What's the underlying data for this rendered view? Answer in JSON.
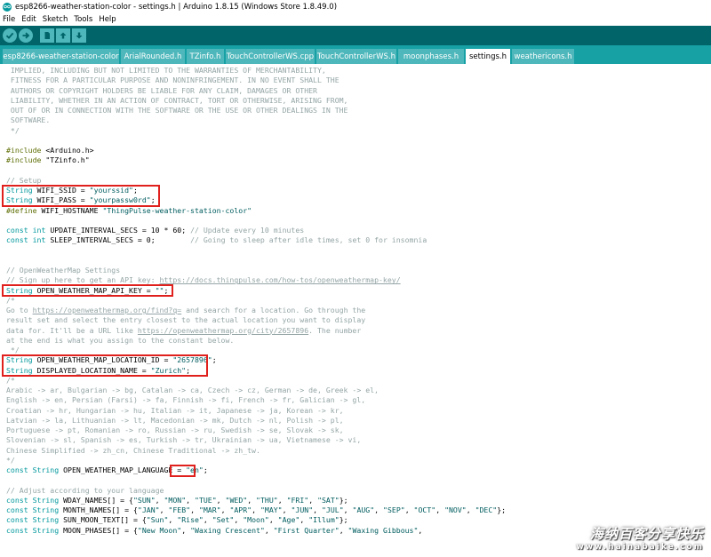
{
  "window": {
    "title": "esp8266-weather-station-color - settings.h | Arduino 1.8.15 (Windows Store 1.8.49.0)",
    "icon": "arduino-icon"
  },
  "menu": [
    "File",
    "Edit",
    "Sketch",
    "Tools",
    "Help"
  ],
  "toolbar": {
    "buttons": [
      "verify-icon",
      "upload-icon",
      "new-icon",
      "open-icon",
      "save-icon"
    ]
  },
  "tabs": [
    {
      "label": "esp8266-weather-station-color",
      "active": false
    },
    {
      "label": "ArialRounded.h",
      "active": false
    },
    {
      "label": "TZinfo.h",
      "active": false
    },
    {
      "label": "TouchControllerWS.cpp",
      "active": false
    },
    {
      "label": "TouchControllerWS.h",
      "active": false
    },
    {
      "label": "moonphases.h",
      "active": false
    },
    {
      "label": "settings.h",
      "active": true
    },
    {
      "label": "weathericons.h",
      "active": false
    }
  ],
  "code": [
    [
      {
        "t": "c",
        "v": " IMPLIED, INCLUDING BUT NOT LIMITED TO THE WARRANTIES OF MERCHANTABILITY,"
      }
    ],
    [
      {
        "t": "c",
        "v": " FITNESS FOR A PARTICULAR PURPOSE AND NONINFRINGEMENT. IN NO EVENT SHALL THE"
      }
    ],
    [
      {
        "t": "c",
        "v": " AUTHORS OR COPYRIGHT HOLDERS BE LIABLE FOR ANY CLAIM, DAMAGES OR OTHER"
      }
    ],
    [
      {
        "t": "c",
        "v": " LIABILITY, WHETHER IN AN ACTION OF CONTRACT, TORT OR OTHERWISE, ARISING FROM,"
      }
    ],
    [
      {
        "t": "c",
        "v": " OUT OF OR IN CONNECTION WITH THE SOFTWARE OR THE USE OR OTHER DEALINGS IN THE"
      }
    ],
    [
      {
        "t": "c",
        "v": " SOFTWARE."
      }
    ],
    [
      {
        "t": "c",
        "v": " */"
      }
    ],
    [],
    [
      {
        "t": "p",
        "v": "#include"
      },
      {
        "t": "n",
        "v": " <Arduino.h>"
      }
    ],
    [
      {
        "t": "p",
        "v": "#include"
      },
      {
        "t": "n",
        "v": " \"TZinfo.h\""
      }
    ],
    [],
    [
      {
        "t": "c",
        "v": "// Setup"
      }
    ],
    [
      {
        "t": "k",
        "v": "String"
      },
      {
        "t": "n",
        "v": " WIFI_SSID = "
      },
      {
        "t": "s",
        "v": "\"yourssid\""
      },
      {
        "t": "n",
        "v": ";"
      }
    ],
    [
      {
        "t": "k",
        "v": "String"
      },
      {
        "t": "n",
        "v": " WIFI_PASS = "
      },
      {
        "t": "s",
        "v": "\"yourpassw0rd\""
      },
      {
        "t": "n",
        "v": ";"
      }
    ],
    [
      {
        "t": "p",
        "v": "#define"
      },
      {
        "t": "n",
        "v": " WIFI_HOSTNAME "
      },
      {
        "t": "s",
        "v": "\"ThingPulse-weather-station-color\""
      }
    ],
    [],
    [
      {
        "t": "k",
        "v": "const"
      },
      {
        "t": "n",
        "v": " "
      },
      {
        "t": "k",
        "v": "int"
      },
      {
        "t": "n",
        "v": " UPDATE_INTERVAL_SECS = 10 * 60; "
      },
      {
        "t": "c",
        "v": "// Update every 10 minutes"
      }
    ],
    [
      {
        "t": "k",
        "v": "const"
      },
      {
        "t": "n",
        "v": " "
      },
      {
        "t": "k",
        "v": "int"
      },
      {
        "t": "n",
        "v": " SLEEP_INTERVAL_SECS = 0;        "
      },
      {
        "t": "c",
        "v": "// Going to sleep after idle times, set 0 for insomnia"
      }
    ],
    [],
    [],
    [
      {
        "t": "c",
        "v": "// OpenWeatherMap Settings"
      }
    ],
    [
      {
        "t": "c",
        "v": "// Sign up here to get an API key: "
      },
      {
        "t": "l",
        "v": "https://docs.thingpulse.com/how-tos/openweathermap-key/"
      }
    ],
    [
      {
        "t": "k",
        "v": "String"
      },
      {
        "t": "n",
        "v": " OPEN_WEATHER_MAP_API_KEY = "
      },
      {
        "t": "s",
        "v": "\"\""
      },
      {
        "t": "n",
        "v": ";"
      }
    ],
    [
      {
        "t": "c",
        "v": "/*"
      }
    ],
    [
      {
        "t": "c",
        "v": "Go to "
      },
      {
        "t": "l",
        "v": "https://openweathermap.org/find?q="
      },
      {
        "t": "c",
        "v": " and search for a location. Go through the"
      }
    ],
    [
      {
        "t": "c",
        "v": "result set and select the entry closest to the actual location you want to display"
      }
    ],
    [
      {
        "t": "c",
        "v": "data for. It'll be a URL like "
      },
      {
        "t": "l",
        "v": "https://openweathermap.org/city/2657896"
      },
      {
        "t": "c",
        "v": ". The number"
      }
    ],
    [
      {
        "t": "c",
        "v": "at the end is what you assign to the constant below."
      }
    ],
    [
      {
        "t": "c",
        "v": " */"
      }
    ],
    [
      {
        "t": "k",
        "v": "String"
      },
      {
        "t": "n",
        "v": " OPEN_WEATHER_MAP_LOCATION_ID = "
      },
      {
        "t": "s",
        "v": "\"2657896\""
      },
      {
        "t": "n",
        "v": ";"
      }
    ],
    [
      {
        "t": "k",
        "v": "String"
      },
      {
        "t": "n",
        "v": " DISPLAYED_LOCATION_NAME = "
      },
      {
        "t": "s",
        "v": "\"Zurich\""
      },
      {
        "t": "n",
        "v": ";"
      }
    ],
    [
      {
        "t": "c",
        "v": "/*"
      }
    ],
    [
      {
        "t": "c",
        "v": "Arabic -> ar, Bulgarian -> bg, Catalan -> ca, Czech -> cz, German -> de, Greek -> el,"
      }
    ],
    [
      {
        "t": "c",
        "v": "English -> en, Persian (Farsi) -> fa, Finnish -> fi, French -> fr, Galician -> gl,"
      }
    ],
    [
      {
        "t": "c",
        "v": "Croatian -> hr, Hungarian -> hu, Italian -> it, Japanese -> ja, Korean -> kr,"
      }
    ],
    [
      {
        "t": "c",
        "v": "Latvian -> la, Lithuanian -> lt, Macedonian -> mk, Dutch -> nl, Polish -> pl,"
      }
    ],
    [
      {
        "t": "c",
        "v": "Portuguese -> pt, Romanian -> ro, Russian -> ru, Swedish -> se, Slovak -> sk,"
      }
    ],
    [
      {
        "t": "c",
        "v": "Slovenian -> sl, Spanish -> es, Turkish -> tr, Ukrainian -> ua, Vietnamese -> vi,"
      }
    ],
    [
      {
        "t": "c",
        "v": "Chinese Simplified -> zh_cn, Chinese Traditional -> zh_tw."
      }
    ],
    [
      {
        "t": "c",
        "v": "*/"
      }
    ],
    [
      {
        "t": "k",
        "v": "const"
      },
      {
        "t": "n",
        "v": " "
      },
      {
        "t": "k",
        "v": "String"
      },
      {
        "t": "n",
        "v": " OPEN_WEATHER_MAP_LANGUAGE = "
      },
      {
        "t": "s",
        "v": "\"en\""
      },
      {
        "t": "n",
        "v": ";"
      }
    ],
    [],
    [
      {
        "t": "c",
        "v": "// Adjust according to your language"
      }
    ],
    [
      {
        "t": "k",
        "v": "const"
      },
      {
        "t": "n",
        "v": " "
      },
      {
        "t": "k",
        "v": "String"
      },
      {
        "t": "n",
        "v": " WDAY_NAMES[] = {"
      },
      {
        "t": "s",
        "v": "\"SUN\""
      },
      {
        "t": "n",
        "v": ", "
      },
      {
        "t": "s",
        "v": "\"MON\""
      },
      {
        "t": "n",
        "v": ", "
      },
      {
        "t": "s",
        "v": "\"TUE\""
      },
      {
        "t": "n",
        "v": ", "
      },
      {
        "t": "s",
        "v": "\"WED\""
      },
      {
        "t": "n",
        "v": ", "
      },
      {
        "t": "s",
        "v": "\"THU\""
      },
      {
        "t": "n",
        "v": ", "
      },
      {
        "t": "s",
        "v": "\"FRI\""
      },
      {
        "t": "n",
        "v": ", "
      },
      {
        "t": "s",
        "v": "\"SAT\""
      },
      {
        "t": "n",
        "v": "};"
      }
    ],
    [
      {
        "t": "k",
        "v": "const"
      },
      {
        "t": "n",
        "v": " "
      },
      {
        "t": "k",
        "v": "String"
      },
      {
        "t": "n",
        "v": " MONTH_NAMES[] = {"
      },
      {
        "t": "s",
        "v": "\"JAN\""
      },
      {
        "t": "n",
        "v": ", "
      },
      {
        "t": "s",
        "v": "\"FEB\""
      },
      {
        "t": "n",
        "v": ", "
      },
      {
        "t": "s",
        "v": "\"MAR\""
      },
      {
        "t": "n",
        "v": ", "
      },
      {
        "t": "s",
        "v": "\"APR\""
      },
      {
        "t": "n",
        "v": ", "
      },
      {
        "t": "s",
        "v": "\"MAY\""
      },
      {
        "t": "n",
        "v": ", "
      },
      {
        "t": "s",
        "v": "\"JUN\""
      },
      {
        "t": "n",
        "v": ", "
      },
      {
        "t": "s",
        "v": "\"JUL\""
      },
      {
        "t": "n",
        "v": ", "
      },
      {
        "t": "s",
        "v": "\"AUG\""
      },
      {
        "t": "n",
        "v": ", "
      },
      {
        "t": "s",
        "v": "\"SEP\""
      },
      {
        "t": "n",
        "v": ", "
      },
      {
        "t": "s",
        "v": "\"OCT\""
      },
      {
        "t": "n",
        "v": ", "
      },
      {
        "t": "s",
        "v": "\"NOV\""
      },
      {
        "t": "n",
        "v": ", "
      },
      {
        "t": "s",
        "v": "\"DEC\""
      },
      {
        "t": "n",
        "v": "};"
      }
    ],
    [
      {
        "t": "k",
        "v": "const"
      },
      {
        "t": "n",
        "v": " "
      },
      {
        "t": "k",
        "v": "String"
      },
      {
        "t": "n",
        "v": " SUN_MOON_TEXT[] = {"
      },
      {
        "t": "s",
        "v": "\"Sun\""
      },
      {
        "t": "n",
        "v": ", "
      },
      {
        "t": "s",
        "v": "\"Rise\""
      },
      {
        "t": "n",
        "v": ", "
      },
      {
        "t": "s",
        "v": "\"Set\""
      },
      {
        "t": "n",
        "v": ", "
      },
      {
        "t": "s",
        "v": "\"Moon\""
      },
      {
        "t": "n",
        "v": ", "
      },
      {
        "t": "s",
        "v": "\"Age\""
      },
      {
        "t": "n",
        "v": ", "
      },
      {
        "t": "s",
        "v": "\"Illum\""
      },
      {
        "t": "n",
        "v": "};"
      }
    ],
    [
      {
        "t": "k",
        "v": "const"
      },
      {
        "t": "n",
        "v": " "
      },
      {
        "t": "k",
        "v": "String"
      },
      {
        "t": "n",
        "v": " MOON_PHASES[] = {"
      },
      {
        "t": "s",
        "v": "\"New Moon\""
      },
      {
        "t": "n",
        "v": ", "
      },
      {
        "t": "s",
        "v": "\"Waxing Crescent\""
      },
      {
        "t": "n",
        "v": ", "
      },
      {
        "t": "s",
        "v": "\"First Quarter\""
      },
      {
        "t": "n",
        "v": ", "
      },
      {
        "t": "s",
        "v": "\"Waxing Gibbous\""
      },
      {
        "t": "n",
        "v": ","
      }
    ]
  ],
  "highlights": [
    {
      "name": "highlight-wifi-credentials",
      "from": 12,
      "to": 13
    },
    {
      "name": "highlight-api-key",
      "from": 22,
      "to": 22
    },
    {
      "name": "highlight-location",
      "from": 29,
      "to": 30
    },
    {
      "name": "highlight-language",
      "from": 40,
      "to": 40
    }
  ],
  "colors": {
    "toolbar": "#006468",
    "tabbar": "#17a1a5",
    "tab": "#4db7bb",
    "keyword": "#00979c",
    "preprocessor": "#5e6d03",
    "comment": "#95a5a6",
    "string": "#005c5f",
    "highlight": "#e0201c"
  },
  "watermark": {
    "text": "海纳百客分享快乐",
    "url": "www.hainabaike.com"
  }
}
